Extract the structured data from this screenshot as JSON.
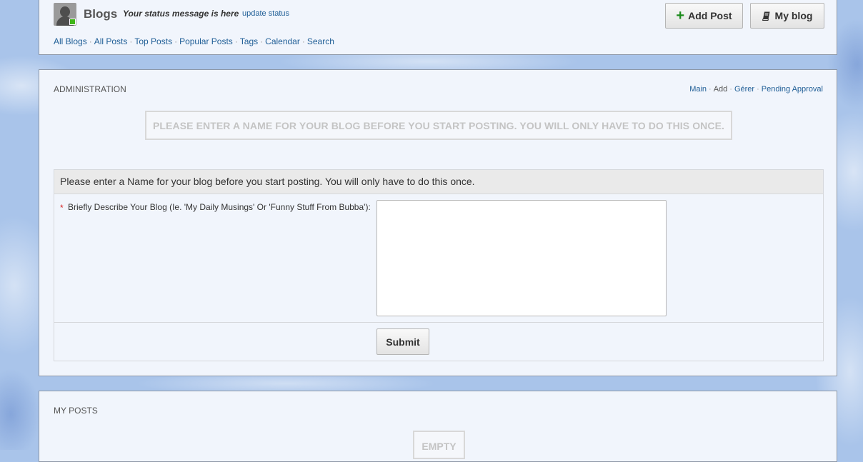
{
  "header": {
    "title": "Blogs",
    "status_message": "Your status message is here",
    "update_status_link": "update status",
    "nav": [
      "All Blogs",
      "All Posts",
      "Top Posts",
      "Popular Posts",
      "Tags",
      "Calendar",
      "Search"
    ],
    "nav_separator": "·",
    "add_post_label": "Add Post",
    "my_blog_label": "My blog"
  },
  "admin": {
    "section_title": "ADMINISTRATION",
    "links": [
      "Main",
      "Add",
      "Gérer",
      "Pending Approval"
    ],
    "current_link": "Add",
    "notice": "Please enter a Name for your blog before you start posting. You will only have to do this once.",
    "form": {
      "heading": "Please enter a Name for your blog before you start posting. You will only have to do this once.",
      "required_marker": "*",
      "field_label": "Briefly Describe Your Blog (Ie. 'My Daily Musings' Or 'Funny Stuff From Bubba'):",
      "field_value": "",
      "submit_label": "Submit"
    }
  },
  "my_posts": {
    "section_title": "MY POSTS",
    "empty_label": "Empty"
  },
  "colors": {
    "link": "#1f5e96",
    "accent_green": "#1a8a1a",
    "required_red": "#d62020",
    "panel_bg": "#f1f5fc"
  },
  "icons": [
    "user-avatar",
    "plus-icon",
    "book-icon"
  ]
}
